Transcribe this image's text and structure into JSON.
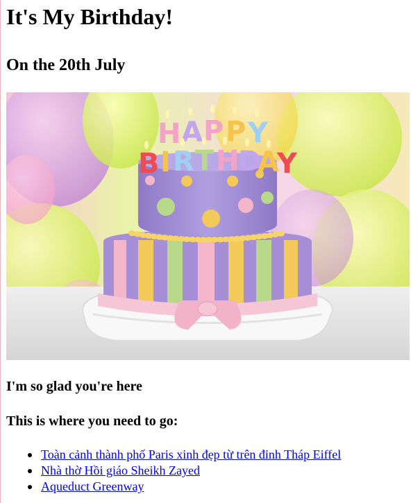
{
  "page": {
    "title": "It's My Birthday!",
    "subtitle": "On the 20th July",
    "image_alt": "birthday-cake-image",
    "greeting": "I'm so glad you're here",
    "directions_heading": "This is where you need to go:",
    "links": [
      {
        "label": "Toàn cảnh thành phố Paris xinh đẹp từ trên đỉnh Tháp Eiffel"
      },
      {
        "label": "Nhà thờ Hồi giáo Sheikh Zayed"
      },
      {
        "label": "Aqueduct Greenway"
      }
    ],
    "cake_text": {
      "line1": "HAPPY",
      "line2": "BIRTHDAY"
    }
  },
  "colors": {
    "link": "#0000ee",
    "text": "#000000",
    "cake_top": "#9b86c9",
    "cake_ribbon": "#f5c6d6",
    "stripe_yellow": "#f3c95a",
    "stripe_green": "#b9d98a"
  }
}
